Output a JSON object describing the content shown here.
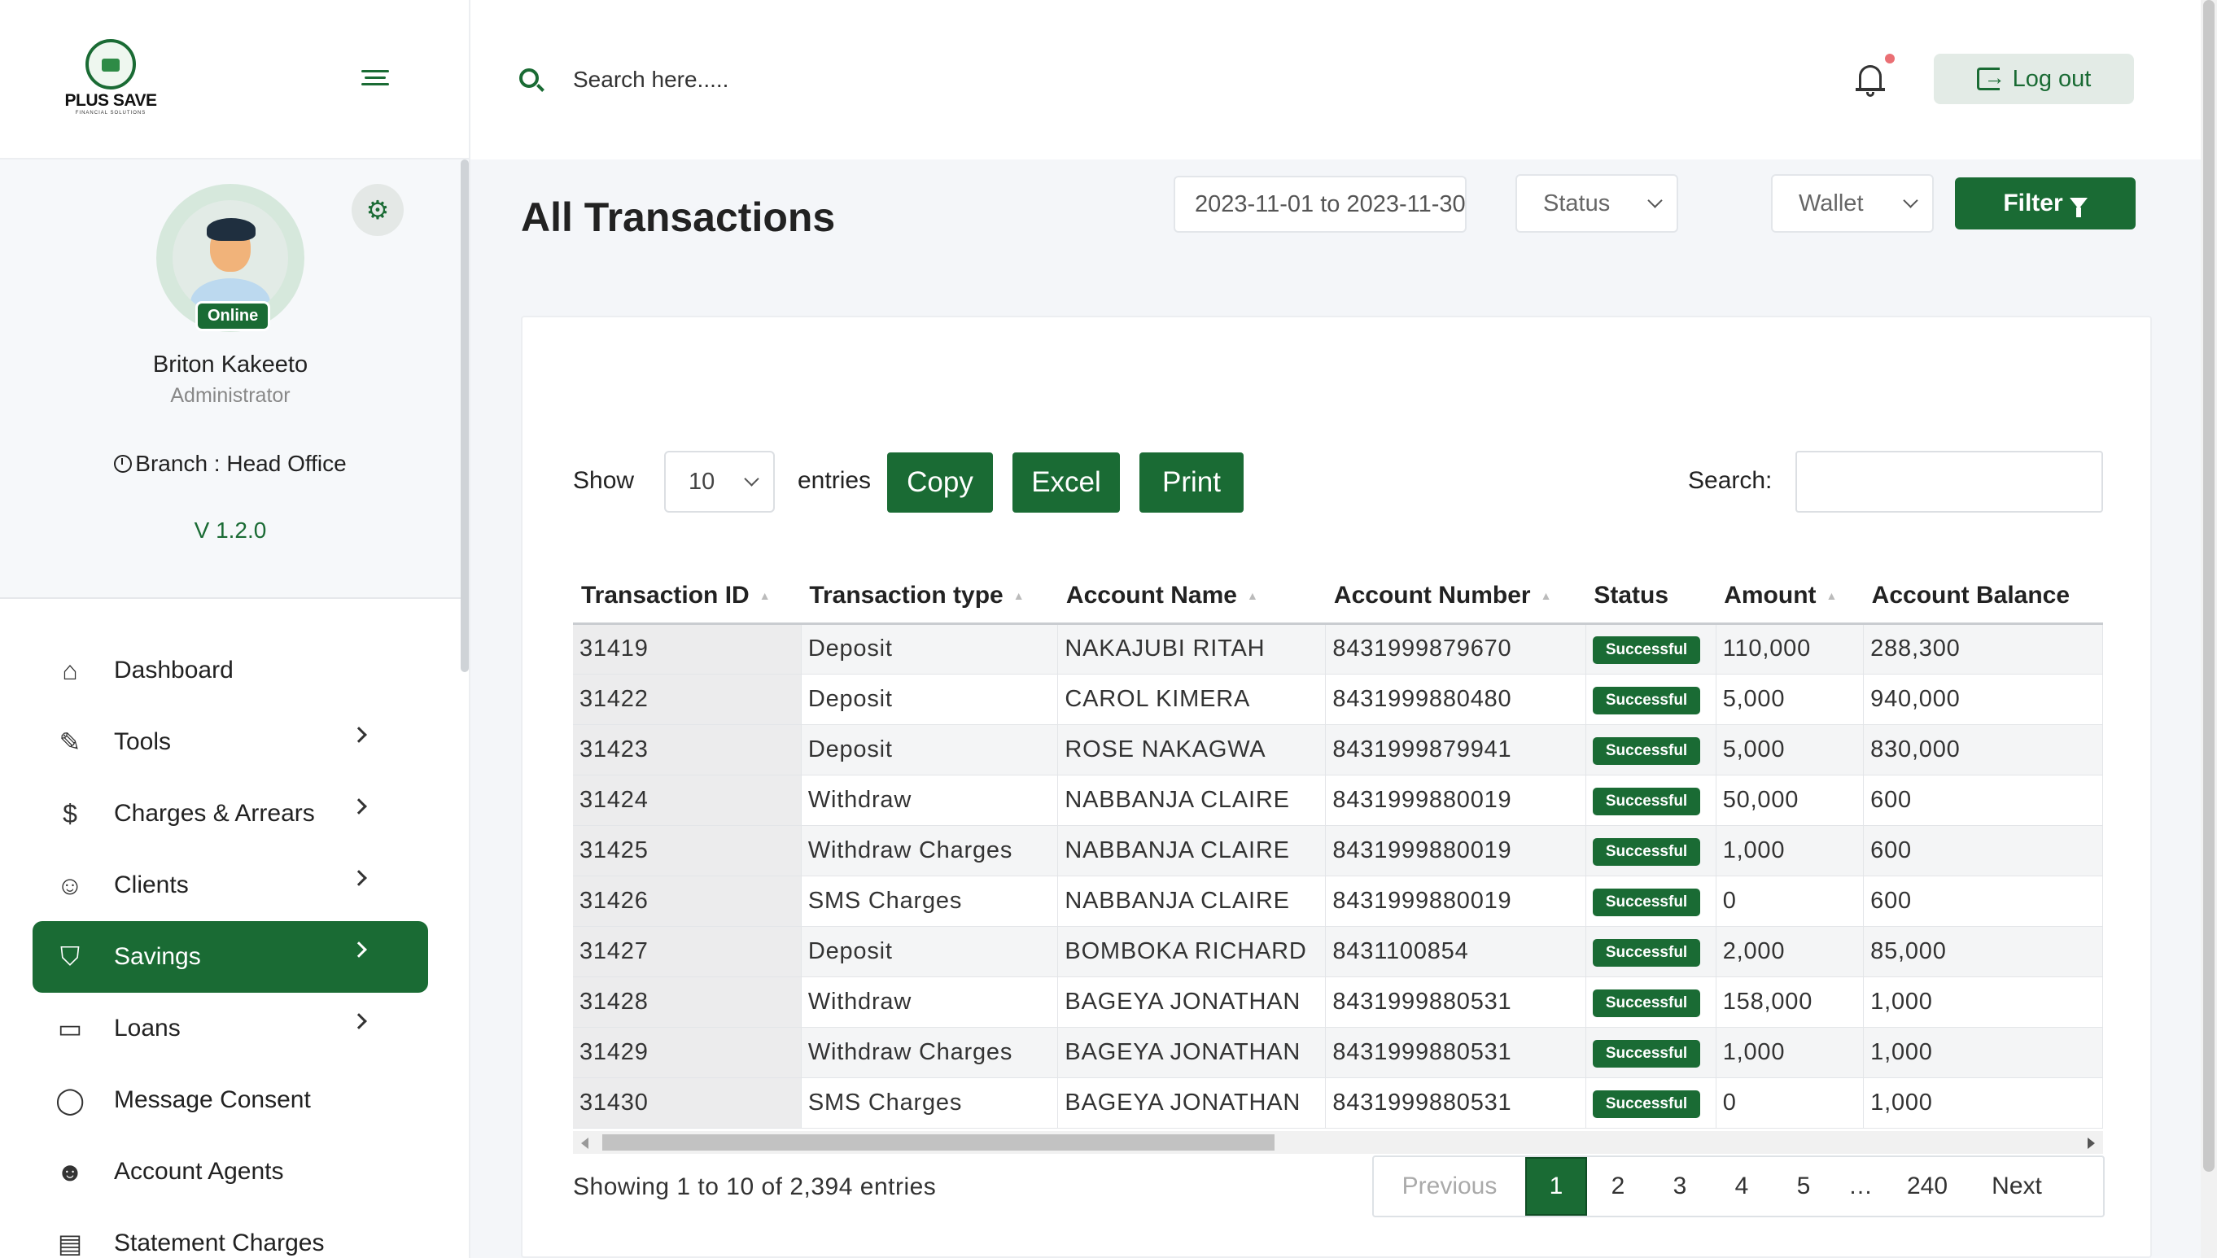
{
  "brand": {
    "name": "PLUS SAVE",
    "tagline": "FINANCIAL SOLUTIONS"
  },
  "profile": {
    "status": "Online",
    "name": "Briton Kakeeto",
    "role": "Administrator",
    "branch": "Branch : Head Office",
    "version": "V 1.2.0"
  },
  "nav": [
    {
      "label": "Dashboard",
      "icon": "home-icon",
      "chevron": false
    },
    {
      "label": "Tools",
      "icon": "wrench-icon",
      "chevron": true
    },
    {
      "label": "Charges & Arrears",
      "icon": "dollar-icon",
      "chevron": true
    },
    {
      "label": "Clients",
      "icon": "users-icon",
      "chevron": true
    },
    {
      "label": "Savings",
      "icon": "shield-icon",
      "chevron": true,
      "active": true
    },
    {
      "label": "Loans",
      "icon": "credit-card-icon",
      "chevron": true
    },
    {
      "label": "Message Consent",
      "icon": "chat-icon",
      "chevron": false
    },
    {
      "label": "Account Agents",
      "icon": "user-check-icon",
      "chevron": false
    },
    {
      "label": "Statement Charges",
      "icon": "document-icon",
      "chevron": false
    }
  ],
  "topbar": {
    "search_placeholder": "Search here.....",
    "logout_label": "Log out"
  },
  "page": {
    "title": "All Transactions",
    "date_range": "2023-11-01 to 2023-11-30",
    "status_placeholder": "Status",
    "wallet_placeholder": "Wallet",
    "filter_label": "Filter"
  },
  "table_controls": {
    "show_label": "Show",
    "page_length": "10",
    "entries_label": "entries",
    "copy_label": "Copy",
    "excel_label": "Excel",
    "print_label": "Print",
    "search_label": "Search:"
  },
  "table": {
    "columns": [
      "Transaction ID",
      "Transaction type",
      "Account Name",
      "Account Number",
      "Status",
      "Amount",
      "Account Balance"
    ],
    "rows": [
      [
        "31419",
        "Deposit",
        "NAKAJUBI RITAH",
        "8431999879670",
        "Successful",
        "110,000",
        "288,300"
      ],
      [
        "31422",
        "Deposit",
        "CAROL KIMERA",
        "8431999880480",
        "Successful",
        "5,000",
        "940,000"
      ],
      [
        "31423",
        "Deposit",
        "ROSE NAKAGWA",
        "8431999879941",
        "Successful",
        "5,000",
        "830,000"
      ],
      [
        "31424",
        "Withdraw",
        "NABBANJA CLAIRE",
        "8431999880019",
        "Successful",
        "50,000",
        "600"
      ],
      [
        "31425",
        "Withdraw Charges",
        "NABBANJA CLAIRE",
        "8431999880019",
        "Successful",
        "1,000",
        "600"
      ],
      [
        "31426",
        "SMS Charges",
        "NABBANJA CLAIRE",
        "8431999880019",
        "Successful",
        "0",
        "600"
      ],
      [
        "31427",
        "Deposit",
        "BOMBOKA RICHARD",
        "8431100854",
        "Successful",
        "2,000",
        "85,000"
      ],
      [
        "31428",
        "Withdraw",
        "BAGEYA JONATHAN",
        "8431999880531",
        "Successful",
        "158,000",
        "1,000"
      ],
      [
        "31429",
        "Withdraw Charges",
        "BAGEYA JONATHAN",
        "8431999880531",
        "Successful",
        "1,000",
        "1,000"
      ],
      [
        "31430",
        "SMS Charges",
        "BAGEYA JONATHAN",
        "8431999880531",
        "Successful",
        "0",
        "1,000"
      ]
    ]
  },
  "pagination": {
    "info": "Showing 1 to 10 of 2,394 entries",
    "previous": "Previous",
    "pages": [
      "1",
      "2",
      "3",
      "4",
      "5",
      "…",
      "240"
    ],
    "current": "1",
    "next": "Next"
  },
  "colors": {
    "primary": "#1a6b34",
    "badge": "#1a6b34",
    "notification_dot": "#ea6f74"
  }
}
